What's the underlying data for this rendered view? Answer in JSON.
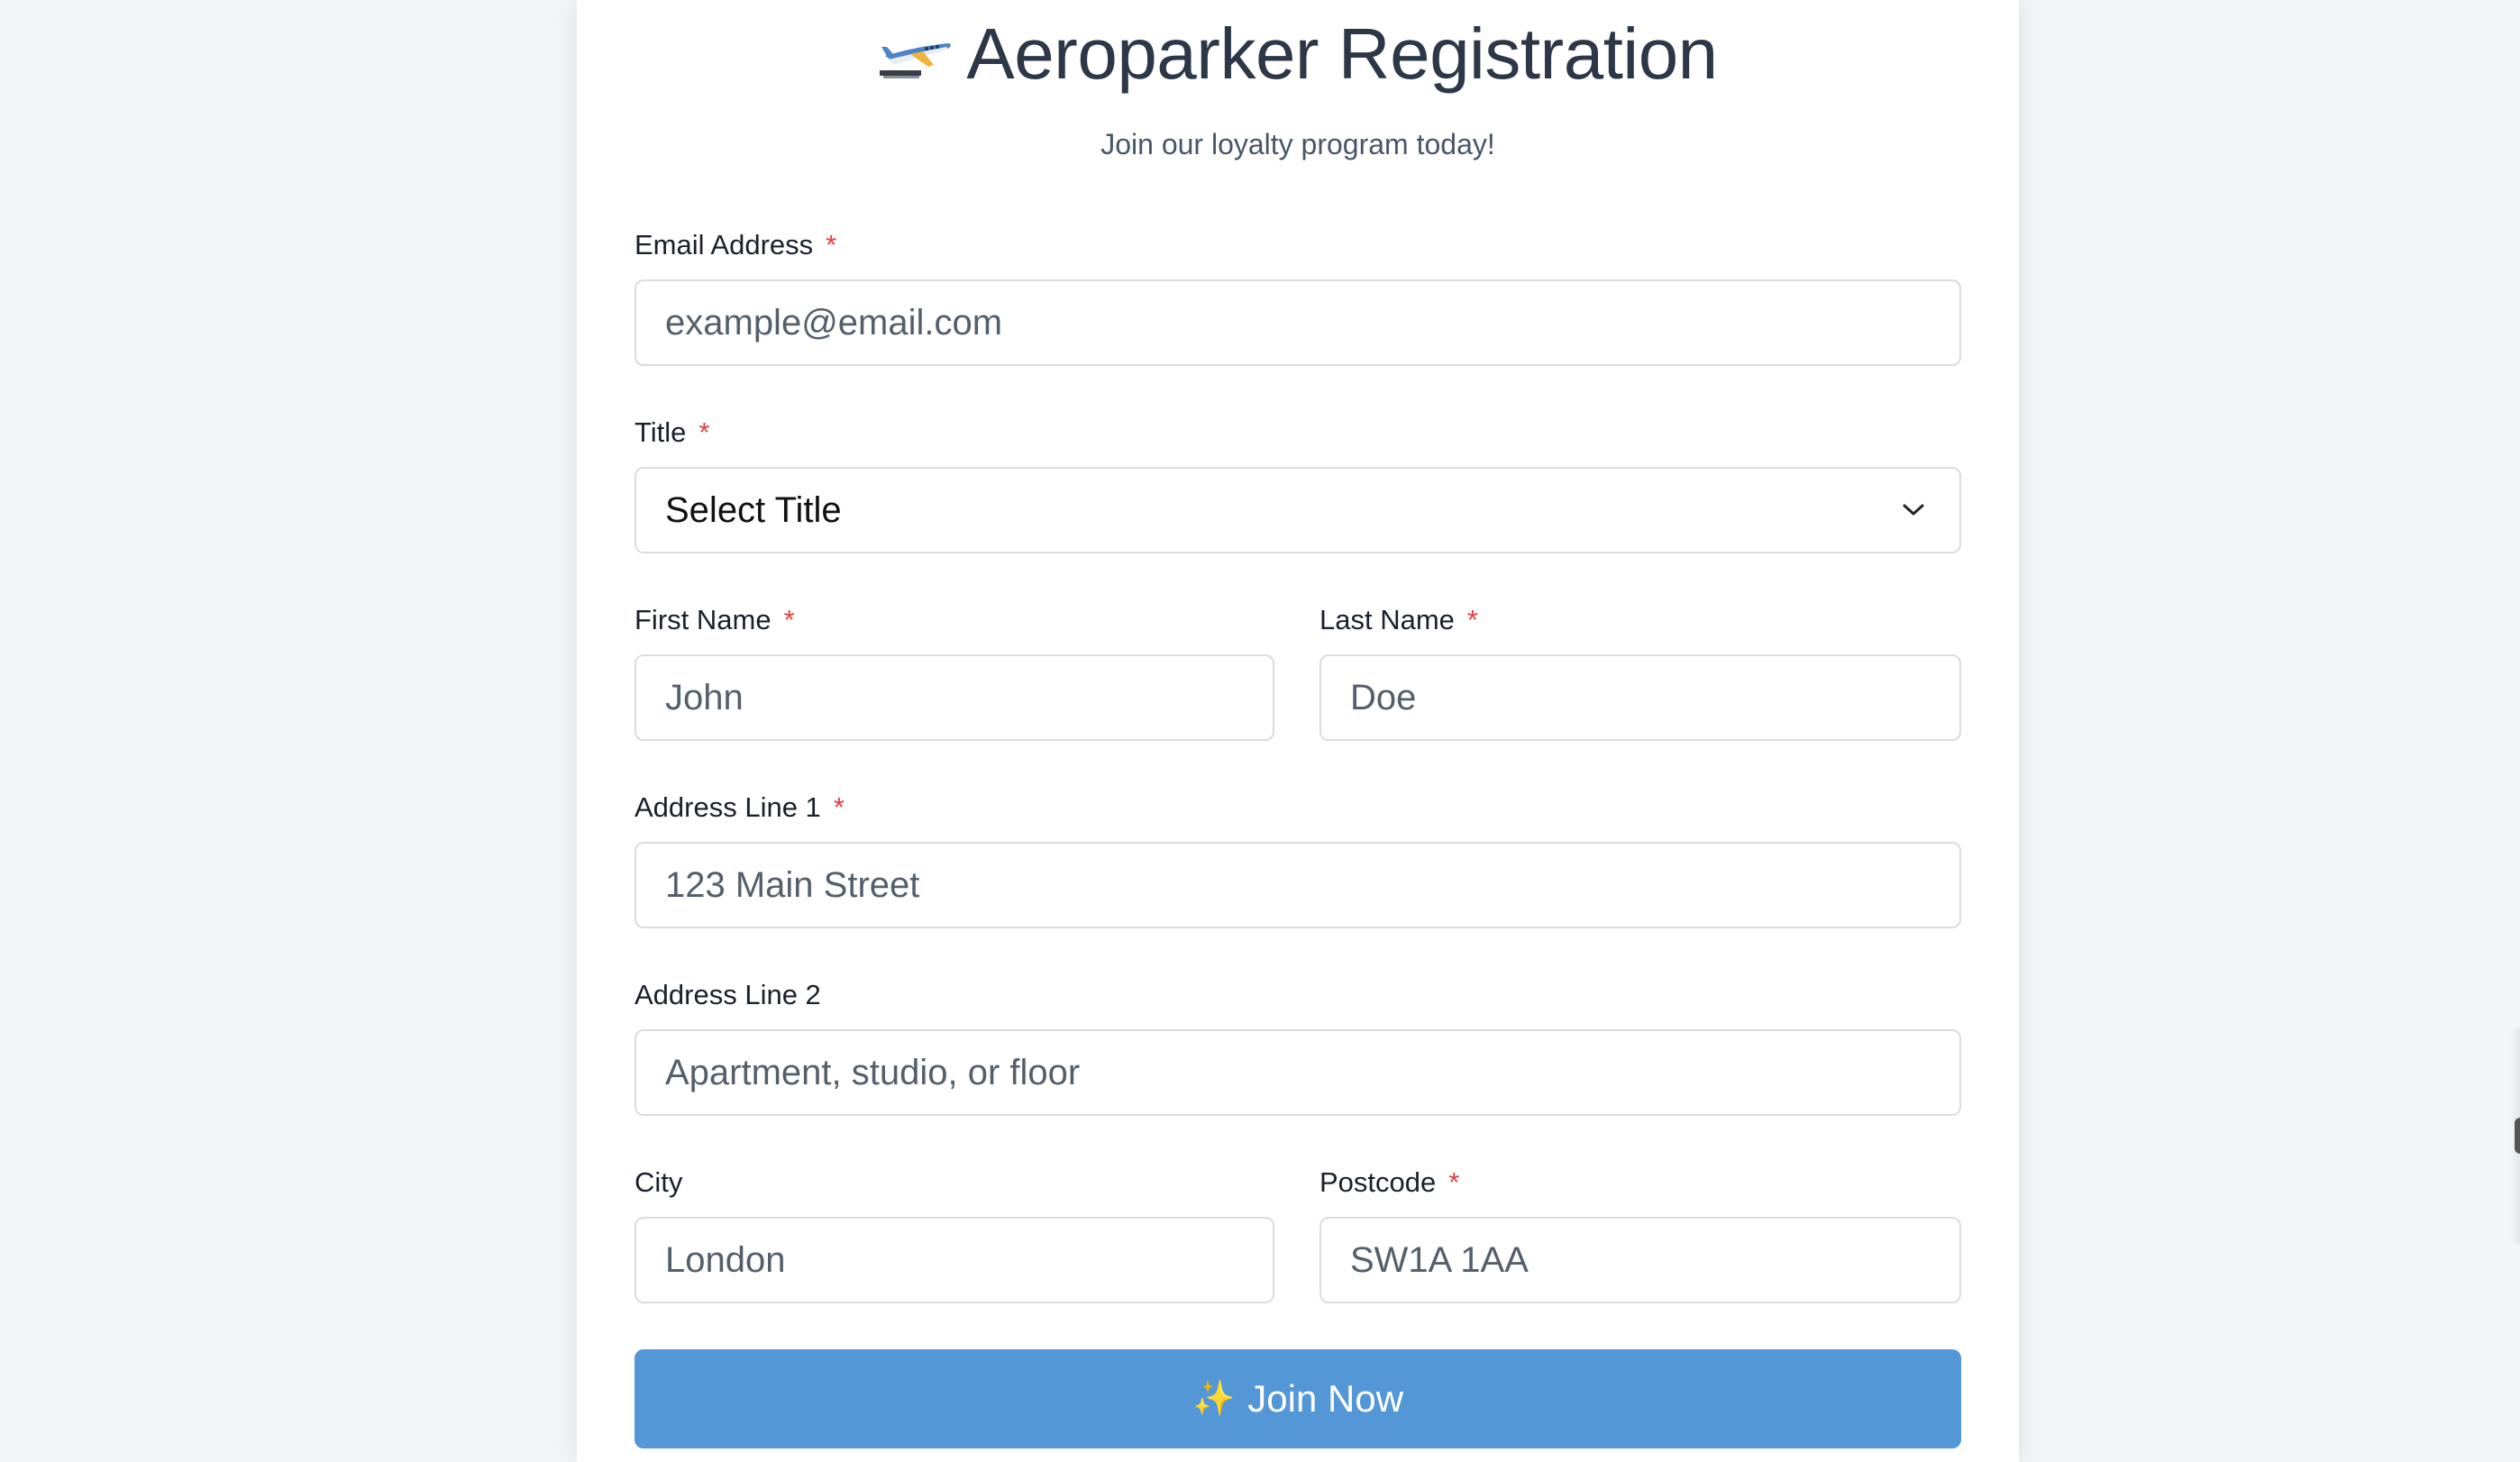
{
  "header": {
    "title": "Aeroparker Registration",
    "subtitle": "Join our loyalty program today!",
    "icon": "airplane-icon"
  },
  "form": {
    "required_marker": "*",
    "email": {
      "label": "Email Address",
      "placeholder": "example@email.com",
      "required": true
    },
    "title": {
      "label": "Title",
      "selected": "Select Title",
      "required": true
    },
    "first_name": {
      "label": "First Name",
      "placeholder": "John",
      "required": true
    },
    "last_name": {
      "label": "Last Name",
      "placeholder": "Doe",
      "required": true
    },
    "address_line_1": {
      "label": "Address Line 1",
      "placeholder": "123 Main Street",
      "required": true
    },
    "address_line_2": {
      "label": "Address Line 2",
      "placeholder": "Apartment, studio, or floor",
      "required": false
    },
    "city": {
      "label": "City",
      "placeholder": "London",
      "required": false
    },
    "postcode": {
      "label": "Postcode",
      "placeholder": "SW1A 1AA",
      "required": true
    },
    "submit": {
      "icon": "sparkles-icon",
      "glyph": "✨",
      "label": "Join Now"
    }
  },
  "colors": {
    "accent": "#5397d6",
    "required": "#e53e3e",
    "background": "#f4f5f7",
    "card": "#ffffff"
  }
}
